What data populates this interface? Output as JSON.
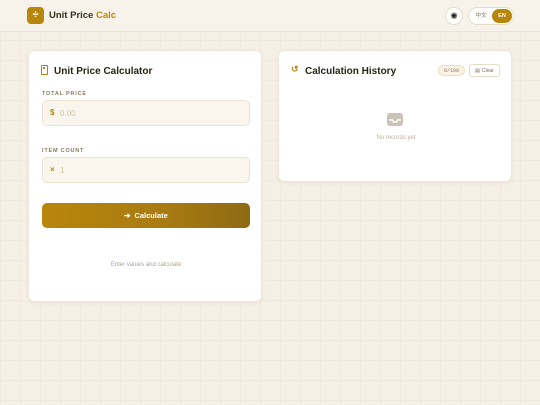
{
  "header": {
    "logo_glyph": "÷",
    "title_main": "Unit Price",
    "title_accent": "Calc",
    "theme_icon": "sun-icon",
    "lang_zh": "中文",
    "lang_en": "EN"
  },
  "calculator": {
    "title": "Unit Price Calculator",
    "total_price_label": "TOTAL PRICE",
    "total_price_prefix": "$",
    "total_price_placeholder": "0.00",
    "total_price_value": "",
    "item_count_label": "ITEM COUNT",
    "item_count_prefix": "×",
    "item_count_placeholder": "1",
    "item_count_value": "",
    "calculate_label": "Calculate",
    "result_hint": "Enter values and calculate"
  },
  "history": {
    "title": "Calculation History",
    "count_badge": "0/100",
    "clear_label": "Clear",
    "empty_text": "No records yet"
  },
  "colors": {
    "accent": "#b8860b",
    "background": "#f5efe6",
    "card": "#ffffff"
  }
}
